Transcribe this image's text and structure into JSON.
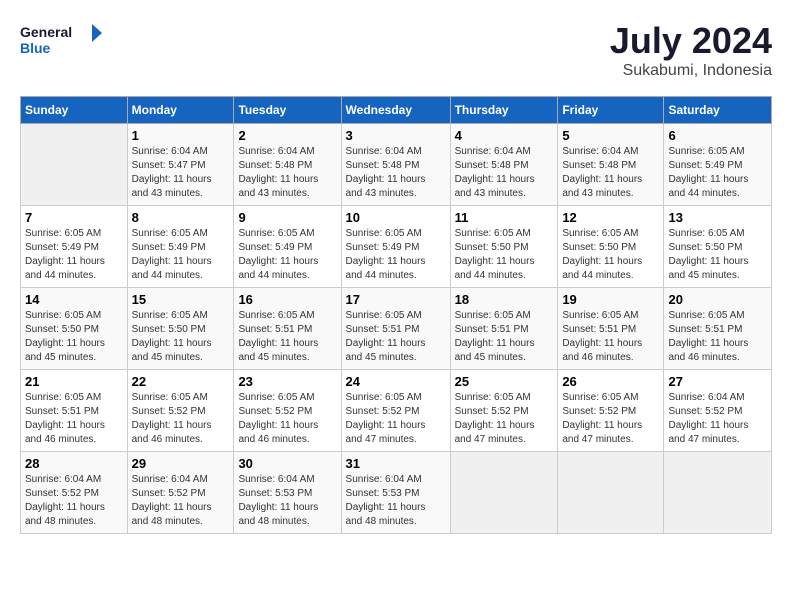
{
  "header": {
    "logo_line1": "General",
    "logo_line2": "Blue",
    "title": "July 2024",
    "subtitle": "Sukabumi, Indonesia"
  },
  "columns": [
    "Sunday",
    "Monday",
    "Tuesday",
    "Wednesday",
    "Thursday",
    "Friday",
    "Saturday"
  ],
  "weeks": [
    [
      {
        "day": "",
        "info": ""
      },
      {
        "day": "1",
        "info": "Sunrise: 6:04 AM\nSunset: 5:47 PM\nDaylight: 11 hours\nand 43 minutes."
      },
      {
        "day": "2",
        "info": "Sunrise: 6:04 AM\nSunset: 5:48 PM\nDaylight: 11 hours\nand 43 minutes."
      },
      {
        "day": "3",
        "info": "Sunrise: 6:04 AM\nSunset: 5:48 PM\nDaylight: 11 hours\nand 43 minutes."
      },
      {
        "day": "4",
        "info": "Sunrise: 6:04 AM\nSunset: 5:48 PM\nDaylight: 11 hours\nand 43 minutes."
      },
      {
        "day": "5",
        "info": "Sunrise: 6:04 AM\nSunset: 5:48 PM\nDaylight: 11 hours\nand 43 minutes."
      },
      {
        "day": "6",
        "info": "Sunrise: 6:05 AM\nSunset: 5:49 PM\nDaylight: 11 hours\nand 44 minutes."
      }
    ],
    [
      {
        "day": "7",
        "info": "Sunrise: 6:05 AM\nSunset: 5:49 PM\nDaylight: 11 hours\nand 44 minutes."
      },
      {
        "day": "8",
        "info": "Sunrise: 6:05 AM\nSunset: 5:49 PM\nDaylight: 11 hours\nand 44 minutes."
      },
      {
        "day": "9",
        "info": "Sunrise: 6:05 AM\nSunset: 5:49 PM\nDaylight: 11 hours\nand 44 minutes."
      },
      {
        "day": "10",
        "info": "Sunrise: 6:05 AM\nSunset: 5:49 PM\nDaylight: 11 hours\nand 44 minutes."
      },
      {
        "day": "11",
        "info": "Sunrise: 6:05 AM\nSunset: 5:50 PM\nDaylight: 11 hours\nand 44 minutes."
      },
      {
        "day": "12",
        "info": "Sunrise: 6:05 AM\nSunset: 5:50 PM\nDaylight: 11 hours\nand 44 minutes."
      },
      {
        "day": "13",
        "info": "Sunrise: 6:05 AM\nSunset: 5:50 PM\nDaylight: 11 hours\nand 45 minutes."
      }
    ],
    [
      {
        "day": "14",
        "info": "Sunrise: 6:05 AM\nSunset: 5:50 PM\nDaylight: 11 hours\nand 45 minutes."
      },
      {
        "day": "15",
        "info": "Sunrise: 6:05 AM\nSunset: 5:50 PM\nDaylight: 11 hours\nand 45 minutes."
      },
      {
        "day": "16",
        "info": "Sunrise: 6:05 AM\nSunset: 5:51 PM\nDaylight: 11 hours\nand 45 minutes."
      },
      {
        "day": "17",
        "info": "Sunrise: 6:05 AM\nSunset: 5:51 PM\nDaylight: 11 hours\nand 45 minutes."
      },
      {
        "day": "18",
        "info": "Sunrise: 6:05 AM\nSunset: 5:51 PM\nDaylight: 11 hours\nand 45 minutes."
      },
      {
        "day": "19",
        "info": "Sunrise: 6:05 AM\nSunset: 5:51 PM\nDaylight: 11 hours\nand 46 minutes."
      },
      {
        "day": "20",
        "info": "Sunrise: 6:05 AM\nSunset: 5:51 PM\nDaylight: 11 hours\nand 46 minutes."
      }
    ],
    [
      {
        "day": "21",
        "info": "Sunrise: 6:05 AM\nSunset: 5:51 PM\nDaylight: 11 hours\nand 46 minutes."
      },
      {
        "day": "22",
        "info": "Sunrise: 6:05 AM\nSunset: 5:52 PM\nDaylight: 11 hours\nand 46 minutes."
      },
      {
        "day": "23",
        "info": "Sunrise: 6:05 AM\nSunset: 5:52 PM\nDaylight: 11 hours\nand 46 minutes."
      },
      {
        "day": "24",
        "info": "Sunrise: 6:05 AM\nSunset: 5:52 PM\nDaylight: 11 hours\nand 47 minutes."
      },
      {
        "day": "25",
        "info": "Sunrise: 6:05 AM\nSunset: 5:52 PM\nDaylight: 11 hours\nand 47 minutes."
      },
      {
        "day": "26",
        "info": "Sunrise: 6:05 AM\nSunset: 5:52 PM\nDaylight: 11 hours\nand 47 minutes."
      },
      {
        "day": "27",
        "info": "Sunrise: 6:04 AM\nSunset: 5:52 PM\nDaylight: 11 hours\nand 47 minutes."
      }
    ],
    [
      {
        "day": "28",
        "info": "Sunrise: 6:04 AM\nSunset: 5:52 PM\nDaylight: 11 hours\nand 48 minutes."
      },
      {
        "day": "29",
        "info": "Sunrise: 6:04 AM\nSunset: 5:52 PM\nDaylight: 11 hours\nand 48 minutes."
      },
      {
        "day": "30",
        "info": "Sunrise: 6:04 AM\nSunset: 5:53 PM\nDaylight: 11 hours\nand 48 minutes."
      },
      {
        "day": "31",
        "info": "Sunrise: 6:04 AM\nSunset: 5:53 PM\nDaylight: 11 hours\nand 48 minutes."
      },
      {
        "day": "",
        "info": ""
      },
      {
        "day": "",
        "info": ""
      },
      {
        "day": "",
        "info": ""
      }
    ]
  ]
}
